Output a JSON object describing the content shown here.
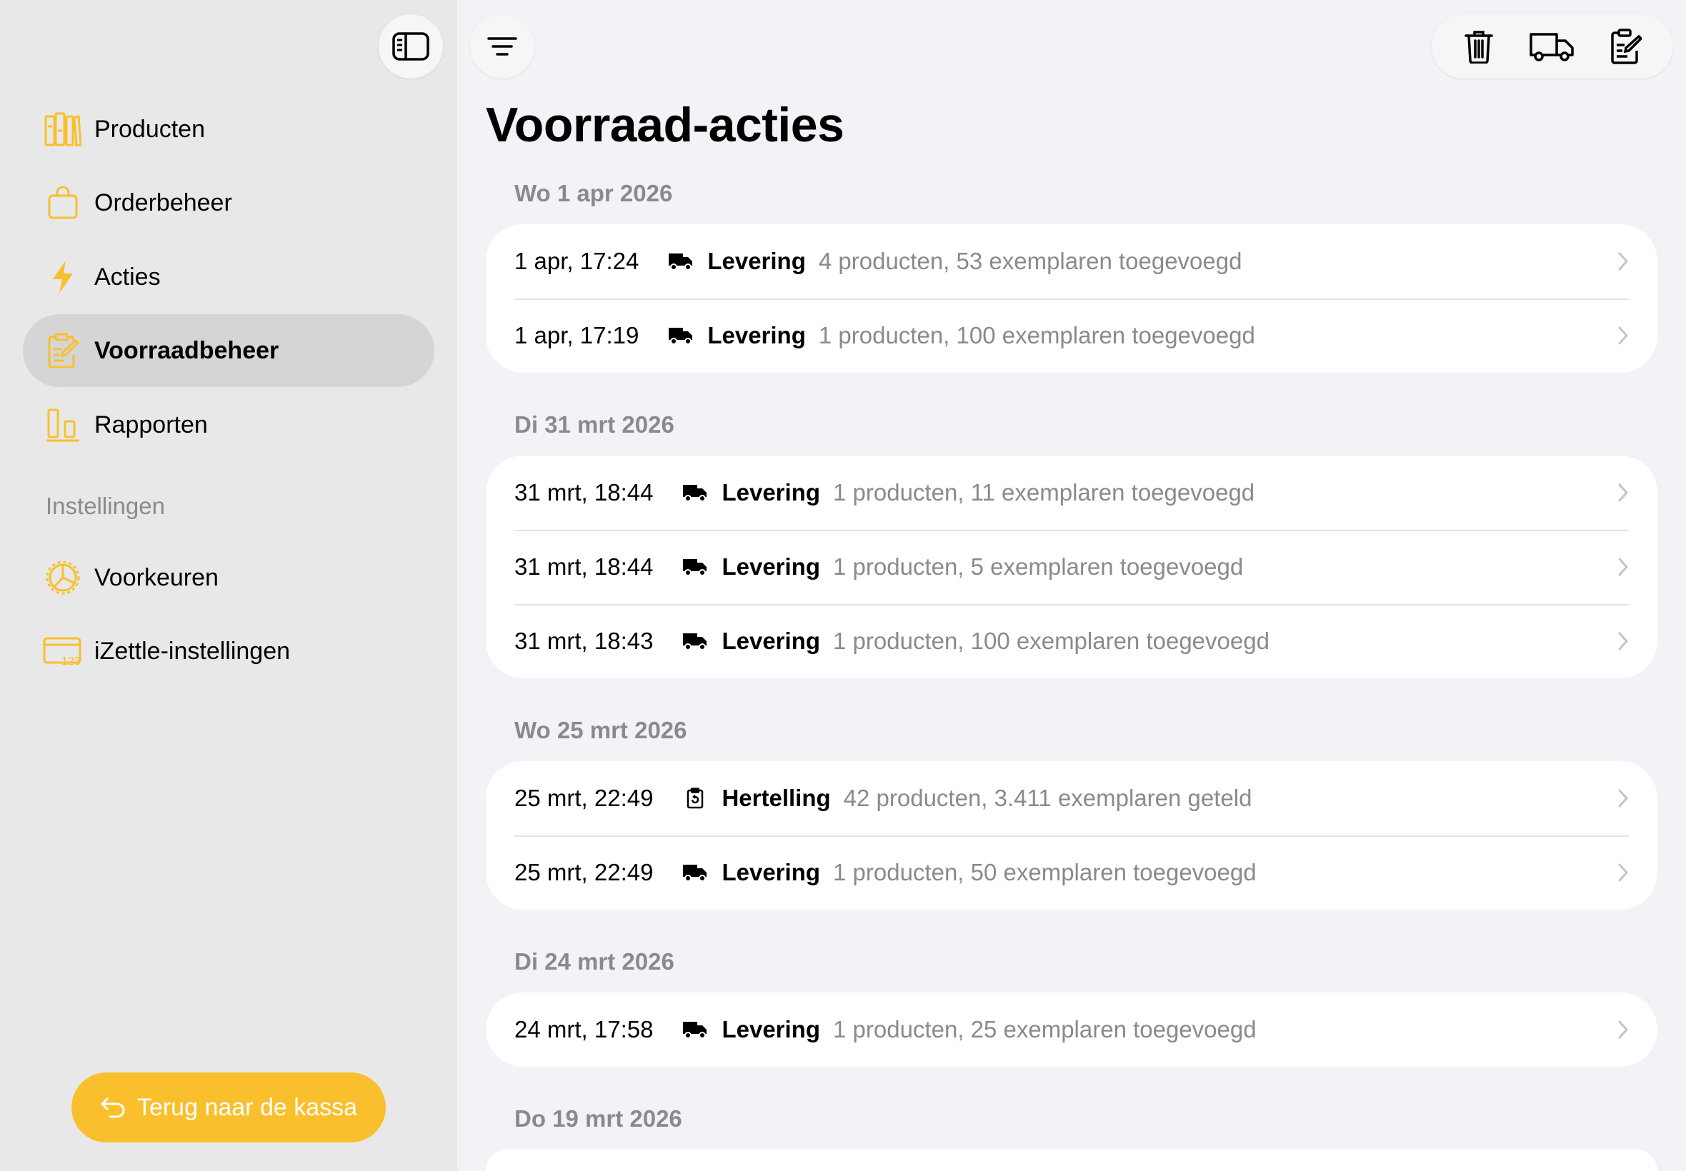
{
  "colors": {
    "accent": "#f9bf2c",
    "sidebar_bg": "#e9e8e8",
    "selected_bg": "#d6d5d5",
    "secondary_text": "#8a8a8e",
    "page_bg": "#f2f2f7"
  },
  "sidebar": {
    "items": [
      {
        "label": "Producten",
        "icon": "books-icon"
      },
      {
        "label": "Orderbeheer",
        "icon": "bag-icon"
      },
      {
        "label": "Acties",
        "icon": "bolt-icon"
      },
      {
        "label": "Voorraadbeheer",
        "icon": "clipboard-edit-icon",
        "selected": true
      },
      {
        "label": "Rapporten",
        "icon": "chart-bars-icon"
      }
    ],
    "section_title": "Instellingen",
    "settings_items": [
      {
        "label": "Voorkeuren",
        "icon": "gear-icon"
      },
      {
        "label": "iZettle-instellingen",
        "icon": "card-123-icon"
      }
    ],
    "back_button": "Terug naar de kassa"
  },
  "main": {
    "title": "Voorraad-acties",
    "groups": [
      {
        "date": "Wo 1 apr 2026",
        "rows": [
          {
            "time": "1 apr, 17:24",
            "type": "Levering",
            "desc": "4 producten, 53 exemplaren toegevoegd",
            "icon": "truck-icon"
          },
          {
            "time": "1 apr, 17:19",
            "type": "Levering",
            "desc": "1 producten, 100 exemplaren toegevoegd",
            "icon": "truck-icon"
          }
        ]
      },
      {
        "date": "Di 31 mrt 2026",
        "rows": [
          {
            "time": "31 mrt, 18:44",
            "type": "Levering",
            "desc": "1 producten, 11 exemplaren toegevoegd",
            "icon": "truck-icon"
          },
          {
            "time": "31 mrt, 18:44",
            "type": "Levering",
            "desc": "1 producten, 5 exemplaren toegevoegd",
            "icon": "truck-icon"
          },
          {
            "time": "31 mrt, 18:43",
            "type": "Levering",
            "desc": "1 producten, 100 exemplaren toegevoegd",
            "icon": "truck-icon"
          }
        ]
      },
      {
        "date": "Wo 25 mrt 2026",
        "rows": [
          {
            "time": "25 mrt, 22:49",
            "type": "Hertelling",
            "desc": "42 producten, 3.411 exemplaren geteld",
            "icon": "recount-icon"
          },
          {
            "time": "25 mrt, 22:49",
            "type": "Levering",
            "desc": "1 producten, 50 exemplaren toegevoegd",
            "icon": "truck-icon"
          }
        ]
      },
      {
        "date": "Di 24 mrt 2026",
        "rows": [
          {
            "time": "24 mrt, 17:58",
            "type": "Levering",
            "desc": "1 producten, 25 exemplaren toegevoegd",
            "icon": "truck-icon"
          }
        ]
      },
      {
        "date": "Do 19 mrt 2026",
        "rows": []
      }
    ]
  },
  "toolbar": {
    "icons": [
      "trash-icon",
      "truck-outline-icon",
      "clipboard-edit-icon"
    ]
  }
}
